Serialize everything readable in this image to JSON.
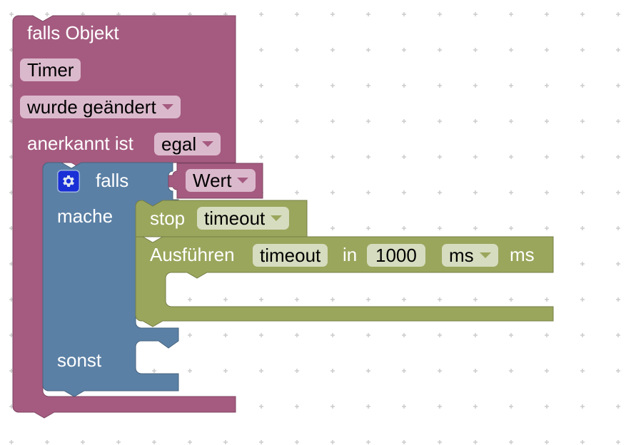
{
  "colors": {
    "event_block": "#a55b80",
    "event_field": "#dbb9cc",
    "logic_block": "#5b80a5",
    "timer_block": "#9aa65c",
    "timer_field": "#d6dcbf",
    "mutator": "#1a2fd6",
    "grid_dot": "#cccccc"
  },
  "trigger_block": {
    "title": "falls Objekt",
    "object_id": "Timer",
    "condition": "wurde geändert",
    "ack_label": "anerkannt ist",
    "ack_value": "egal"
  },
  "if_block": {
    "mutator_icon": "gear-icon",
    "if_label": "falls",
    "do_label": "mache",
    "else_label": "sonst",
    "condition_value": "Wert"
  },
  "stop_block": {
    "label": "stop",
    "timeout_name": "timeout"
  },
  "timeout_block": {
    "label": "Ausführen",
    "timeout_name": "timeout",
    "in_label": "in",
    "delay": "1000",
    "unit": "ms",
    "unit_suffix": "ms"
  }
}
